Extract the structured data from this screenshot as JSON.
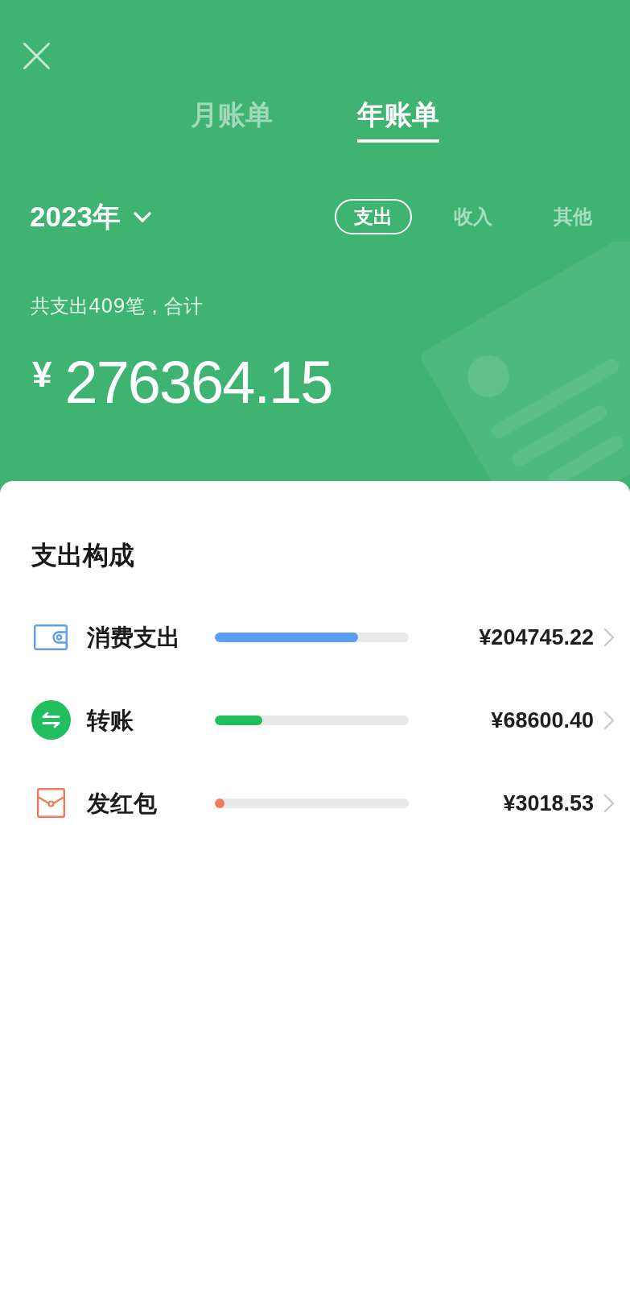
{
  "tabs": [
    {
      "label": "月账单",
      "selected": false
    },
    {
      "label": "年账单",
      "selected": true
    }
  ],
  "year_picker": {
    "label": "2023年"
  },
  "filters": [
    {
      "label": "支出",
      "selected": true
    },
    {
      "label": "收入",
      "selected": false
    },
    {
      "label": "其他",
      "selected": false
    }
  ],
  "summary": {
    "caption": "共支出409笔，合计",
    "currency": "¥",
    "amount": "276364.15"
  },
  "breakdown": {
    "title": "支出构成",
    "items": [
      {
        "kind": "wallet",
        "label": "消费支出",
        "level": 0.74,
        "color": "#5b9ef2",
        "amount": "¥204745.22"
      },
      {
        "kind": "transfer",
        "label": "转账",
        "level": 0.245,
        "color": "#1fbf5f",
        "amount": "¥68600.40"
      },
      {
        "kind": "red-packet",
        "label": "发红包",
        "level": 0.011,
        "color": "#f07a5a",
        "amount": "¥3018.53"
      }
    ]
  }
}
